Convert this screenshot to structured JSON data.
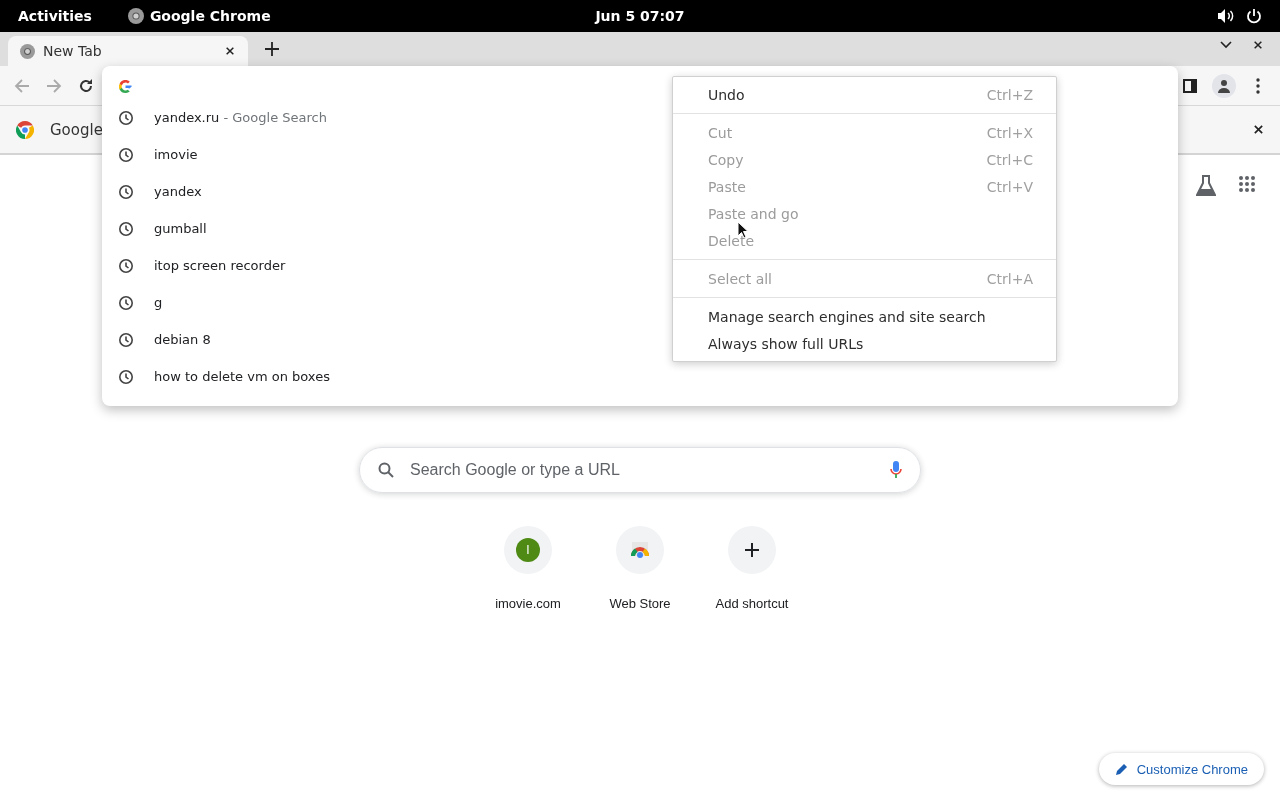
{
  "top_bar": {
    "activities": "Activities",
    "app_name": "Google Chrome",
    "clock": "Jun 5  07:07"
  },
  "tabs": [
    {
      "title": "New Tab",
      "selected": true
    }
  ],
  "infobar": {
    "text": "Google"
  },
  "omnibox": {
    "suggestions": [
      {
        "text": "yandex.ru",
        "detail": " - Google Search"
      },
      {
        "text": "imovie"
      },
      {
        "text": "yandex"
      },
      {
        "text": "gumball"
      },
      {
        "text": "itop screen recorder"
      },
      {
        "text": "g"
      },
      {
        "text": "debian 8"
      },
      {
        "text": "how to delete vm on boxes"
      }
    ]
  },
  "context_menu": {
    "groups": [
      [
        {
          "label": "Undo",
          "shortcut": "Ctrl+Z",
          "disabled": false
        }
      ],
      [
        {
          "label": "Cut",
          "shortcut": "Ctrl+X",
          "disabled": true
        },
        {
          "label": "Copy",
          "shortcut": "Ctrl+C",
          "disabled": true
        },
        {
          "label": "Paste",
          "shortcut": "Ctrl+V",
          "disabled": true
        },
        {
          "label": "Paste and go",
          "disabled": true
        },
        {
          "label": "Delete",
          "disabled": true
        }
      ],
      [
        {
          "label": "Select all",
          "shortcut": "Ctrl+A",
          "disabled": true
        }
      ],
      [
        {
          "label": "Manage search engines and site search",
          "disabled": false
        },
        {
          "label": "Always show full URLs",
          "disabled": false
        }
      ]
    ]
  },
  "search": {
    "placeholder": "Search Google or type a URL"
  },
  "shortcuts": [
    {
      "kind": "letter",
      "letter": "I",
      "label": "imovie.com",
      "color": "#4e8a14"
    },
    {
      "kind": "store",
      "label": "Web Store"
    },
    {
      "kind": "add",
      "label": "Add shortcut"
    }
  ],
  "customize": {
    "label": "Customize Chrome"
  }
}
